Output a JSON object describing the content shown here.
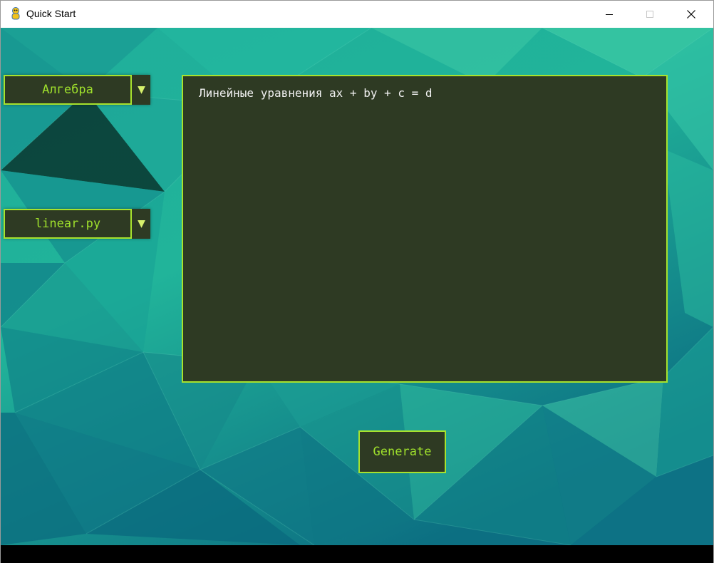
{
  "window": {
    "title": "Quick Start",
    "icon": "pygame-snake-icon"
  },
  "controls": {
    "minimize": "minimize-icon",
    "maximize": "maximize-icon",
    "close": "close-icon"
  },
  "sidebar": {
    "subject_dropdown": {
      "value": "Алгебра",
      "arrow": "▼"
    },
    "module_dropdown": {
      "value": "linear.py",
      "arrow": "▼"
    }
  },
  "panel": {
    "text": "Линейные уравнения ax + by + c = d"
  },
  "actions": {
    "generate_label": "Generate"
  },
  "colors": {
    "accent": "#a7e22d",
    "label_text": "#9fe02c",
    "panel_bg": "#2e3a23",
    "panel_text": "#f2f2f2",
    "background_teal": "#0f7f8a"
  }
}
